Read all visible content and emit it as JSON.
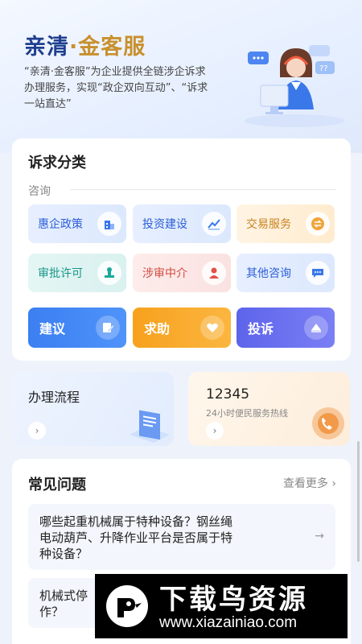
{
  "hero": {
    "title_a": "亲清",
    "title_dot": "·",
    "title_b": "金客服",
    "description": "“亲清·金客服”为企业提供全链涉企诉求办理服务，实现“政企双向互动”、“诉求一站直达”"
  },
  "categories": {
    "title": "诉求分类",
    "consult_label": "咨询",
    "tiles": [
      {
        "label": "惠企政策",
        "icon": "building-icon"
      },
      {
        "label": "投资建设",
        "icon": "trend-chart-icon"
      },
      {
        "label": "交易服务",
        "icon": "exchange-icon"
      },
      {
        "label": "审批许可",
        "icon": "stamp-icon"
      },
      {
        "label": "涉审中介",
        "icon": "agent-icon"
      },
      {
        "label": "其他咨询",
        "icon": "chat-icon"
      }
    ],
    "actions": [
      {
        "label": "建议",
        "icon": "edit-icon"
      },
      {
        "label": "求助",
        "icon": "handshake-heart-icon"
      },
      {
        "label": "投诉",
        "icon": "complaint-icon"
      }
    ]
  },
  "process": {
    "title": "办理流程",
    "icon": "document-stack-icon"
  },
  "hotline": {
    "number": "12345",
    "caption": "24小时便民服务热线",
    "icon": "phone-icon"
  },
  "faq": {
    "title": "常见问题",
    "more_label": "查看更多",
    "questions": [
      {
        "line1": "哪些起重机械属于特种设备？钢丝绳",
        "line2": "电动葫芦、升降作业平台是否属于特",
        "line3": "种设备？"
      },
      {
        "line1": "机械式停",
        "line2": "作？"
      }
    ]
  },
  "watermark": {
    "title": "下载鸟资源",
    "url": "www.xiazainiao.com"
  },
  "colors": {
    "brand_blue": "#1f3f8f",
    "brand_gold": "#c8902e",
    "action_blue": "#3b7ff2",
    "action_orange": "#f7a11d",
    "action_purple": "#5d64ea"
  }
}
